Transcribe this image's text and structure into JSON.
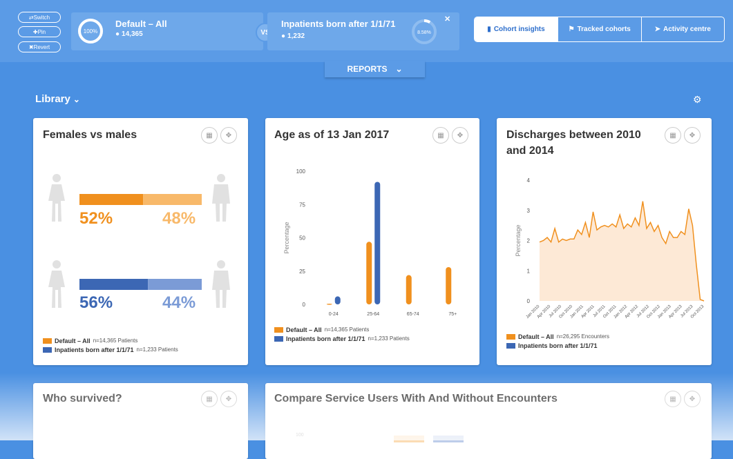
{
  "controls": {
    "switch_label": "⇄Switch",
    "pin_label": "✚Pin",
    "revert_label": "✖Revert"
  },
  "cohort_a": {
    "name": "Default – All",
    "count": "14,365",
    "ring_text": "100%",
    "ring_fraction": 1.0
  },
  "vs_label": "VS",
  "cohort_b": {
    "name": "Inpatients born after 1/1/71",
    "count": "1,232",
    "ring_text": "8.58%",
    "ring_fraction": 0.0858
  },
  "nav": {
    "tabs": [
      {
        "label": "Cohort insights",
        "icon": "bar-chart-icon",
        "active": true
      },
      {
        "label": "Tracked cohorts",
        "icon": "flag-icon",
        "active": false
      },
      {
        "label": "Activity centre",
        "icon": "paper-plane-icon",
        "active": false
      }
    ]
  },
  "reports_label": "REPORTS",
  "library_label": "Library",
  "colors": {
    "orange": "#f0901e",
    "orange_light": "#f8b96a",
    "blue": "#3c67b4",
    "blue_light": "#7b9bd6",
    "area_fill": "#fde9d6"
  },
  "cards": {
    "females_vs_males": {
      "title": "Females vs males",
      "rows": [
        {
          "female_pct": "52%",
          "male_pct": "48%",
          "female_fraction": 0.52
        },
        {
          "female_pct": "56%",
          "male_pct": "44%",
          "female_fraction": 0.56
        }
      ],
      "legend": [
        {
          "label": "Default – All",
          "n": "n=14,365 Patients"
        },
        {
          "label": "Inpatients born after 1/1/71",
          "n": "n=1,233 Patients"
        }
      ]
    },
    "age": {
      "title": "Age as of 13 Jan 2017",
      "legend": [
        {
          "label": "Default – All",
          "n": "n=14,365 Patients"
        },
        {
          "label": "Inpatients born after 1/1/71",
          "n": "n=1,233 Patients"
        }
      ]
    },
    "discharges": {
      "title": "Discharges between 2010 and 2014",
      "legend": [
        {
          "label": "Default – All",
          "n": "n=26,295 Encounters"
        },
        {
          "label": "Inpatients born after 1/1/71",
          "n": ""
        }
      ]
    },
    "who_survived": {
      "title": "Who survived?"
    },
    "compare": {
      "title": "Compare Service Users With And Without Encounters",
      "partial_tick": "100"
    }
  },
  "chart_data": [
    {
      "type": "bar",
      "title": "Age as of 13 Jan 2017",
      "xlabel": "",
      "ylabel": "Percentage",
      "ylim": [
        0,
        100
      ],
      "yticks": [
        0,
        25,
        50,
        75,
        100
      ],
      "categories": [
        "0-24",
        "25-64",
        "65-74",
        "75+"
      ],
      "series": [
        {
          "name": "Default – All",
          "values": [
            0.5,
            47,
            22,
            28
          ]
        },
        {
          "name": "Inpatients born after 1/1/71",
          "values": [
            6,
            92,
            0,
            0
          ]
        }
      ]
    },
    {
      "type": "area",
      "title": "Discharges between 2010 and 2014",
      "xlabel": "",
      "ylabel": "Percentage",
      "ylim": [
        0,
        4
      ],
      "yticks": [
        0,
        1,
        2,
        3,
        4
      ],
      "xticks": [
        "Jan 2010",
        "Apr 2010",
        "Jul 2010",
        "Oct 2010",
        "Jan 2011",
        "Apr 2011",
        "Jul 2011",
        "Oct 2011",
        "Jan 2012",
        "Apr 2012",
        "Jul 2012",
        "Oct 2012",
        "Jan 2013",
        "Apr 2013",
        "Jul 2013",
        "Oct 2013"
      ],
      "series": [
        {
          "name": "Default – All",
          "values": [
            1.95,
            2.0,
            2.1,
            1.95,
            2.4,
            1.95,
            2.05,
            2.0,
            2.05,
            2.05,
            2.35,
            2.2,
            2.6,
            2.1,
            2.95,
            2.35,
            2.45,
            2.5,
            2.45,
            2.55,
            2.45,
            2.85,
            2.4,
            2.55,
            2.45,
            2.75,
            2.5,
            3.3,
            2.4,
            2.6,
            2.3,
            2.5,
            2.1,
            1.9,
            2.3,
            2.1,
            2.1,
            2.3,
            2.2,
            3.05,
            2.5,
            1.2,
            0.05,
            0.0
          ]
        }
      ]
    }
  ]
}
